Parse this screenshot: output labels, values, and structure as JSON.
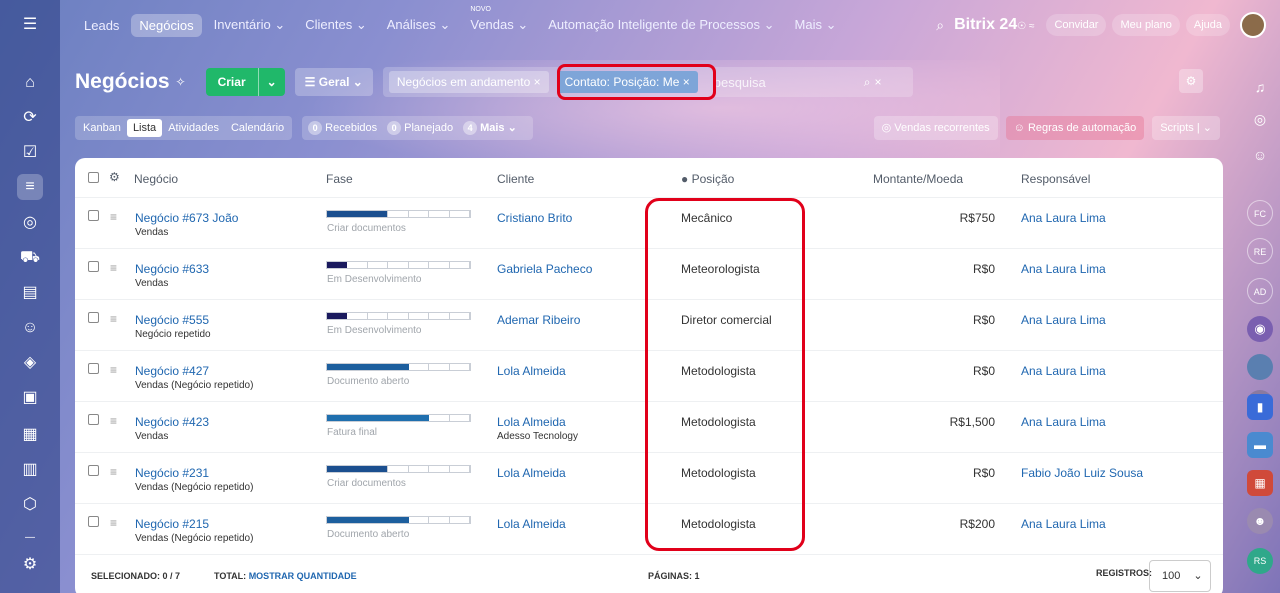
{
  "topnav": {
    "menu_icon": "menu-icon",
    "items": [
      {
        "label": "Leads"
      },
      {
        "label": "Negócios",
        "active": true
      },
      {
        "label": "Inventário ⌄"
      },
      {
        "label": "Clientes ⌄"
      },
      {
        "label": "Análises ⌄"
      },
      {
        "label": "Vendas ⌄",
        "sup": "NOVO"
      },
      {
        "label": "Automação Inteligente de Processos ⌄"
      },
      {
        "label": "Mais ⌄"
      }
    ],
    "brand": "Bitrix 24",
    "brand_mark": "☉ ≈",
    "invite": "Convidar",
    "plan": "Meu plano",
    "help": "Ajuda"
  },
  "header": {
    "title": "Negócios",
    "create": "Criar",
    "geral": "Geral",
    "chip1": "Negócios em andamento",
    "chip2": "Contato: Posição: Me",
    "search_placeholder": "pesquisa"
  },
  "toolbar": {
    "views": [
      "Kanban",
      "Lista",
      "Atividades",
      "Calendário"
    ],
    "counters": [
      {
        "n": "0",
        "label": "Recebidos"
      },
      {
        "n": "0",
        "label": "Planejado"
      },
      {
        "n": "4",
        "label": "Mais"
      }
    ],
    "recurring": "Vendas recorrentes",
    "automation": "Regras de automação",
    "scripts": "Scripts"
  },
  "table": {
    "headers": {
      "deal": "Negócio",
      "phase": "Fase",
      "client": "Cliente",
      "position": "Posição",
      "amount": "Montante/Moeda",
      "owner": "Responsável"
    },
    "rows": [
      {
        "deal": "Negócio #673 João",
        "sub": "Vendas",
        "phase": "Criar documentos",
        "phase_fill": 0.42,
        "phase_color": "#1b4f8f",
        "client": "Cristiano Brito",
        "client_sub": "",
        "position": "Mecânico",
        "amount": "R$750",
        "owner": "Ana Laura Lima"
      },
      {
        "deal": "Negócio #633",
        "sub": "Vendas",
        "phase": "Em Desenvolvimento",
        "phase_fill": 0.14,
        "phase_color": "#1a1a5e",
        "client": "Gabriela Pacheco",
        "client_sub": "",
        "position": "Meteorologista",
        "amount": "R$0",
        "owner": "Ana Laura Lima"
      },
      {
        "deal": "Negócio #555",
        "sub": "Negócio repetido",
        "phase": "Em Desenvolvimento",
        "phase_fill": 0.14,
        "phase_color": "#1a1a5e",
        "client": "Ademar Ribeiro",
        "client_sub": "",
        "position": "Diretor comercial",
        "amount": "R$0",
        "owner": "Ana Laura Lima"
      },
      {
        "deal": "Negócio #427",
        "sub": "Vendas (Negócio repetido)",
        "phase": "Documento aberto",
        "phase_fill": 0.57,
        "phase_color": "#1d5f9e",
        "client": "Lola Almeida",
        "client_sub": "",
        "position": "Metodologista",
        "amount": "R$0",
        "owner": "Ana Laura Lima"
      },
      {
        "deal": "Negócio #423",
        "sub": "Vendas",
        "phase": "Fatura final",
        "phase_fill": 0.71,
        "phase_color": "#1f6fae",
        "client": "Lola Almeida",
        "client_sub": "Adesso Tecnology",
        "position": "Metodologista",
        "amount": "R$1,500",
        "owner": "Ana Laura Lima"
      },
      {
        "deal": "Negócio #231",
        "sub": "Vendas (Negócio repetido)",
        "phase": "Criar documentos",
        "phase_fill": 0.42,
        "phase_color": "#1b4f8f",
        "client": "Lola Almeida",
        "client_sub": "",
        "position": "Metodologista",
        "amount": "R$0",
        "owner": "Fabio João Luiz Sousa"
      },
      {
        "deal": "Negócio #215",
        "sub": "Vendas (Negócio repetido)",
        "phase": "Documento aberto",
        "phase_fill": 0.57,
        "phase_color": "#1d5f9e",
        "client": "Lola Almeida",
        "client_sub": "",
        "position": "Metodologista",
        "amount": "R$200",
        "owner": "Ana Laura Lima"
      }
    ]
  },
  "footer": {
    "selected_label": "SELECIONADO:",
    "selected_value": "0 / 7",
    "total_label": "TOTAL:",
    "total_link": "MOSTRAR QUANTIDADE",
    "pages": "PÁGINAS: 1",
    "records": "REGISTROS:",
    "page_size": "100"
  },
  "rightbar": {
    "initials": [
      "FC",
      "RE",
      "AD",
      "RS"
    ]
  }
}
